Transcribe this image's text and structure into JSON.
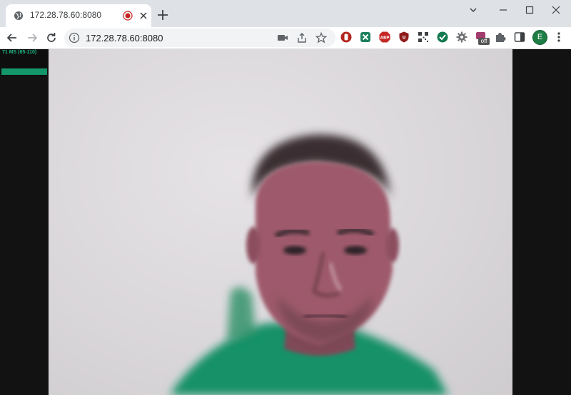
{
  "browser": {
    "tab": {
      "title": "172.28.78.60:8080"
    },
    "address_bar": {
      "url": "172.28.78.60:8080"
    },
    "extensions": [
      "video-camera-icon",
      "share-icon",
      "bookmark-star-icon",
      "extension-red-icon",
      "extension-green-x-icon",
      "adblock-icon",
      "extension-shield-icon",
      "qr-code-icon",
      "extension-check-icon",
      "extension-gear-icon",
      "extension-off-icon",
      "extensions-puzzle-icon",
      "side-panel-icon"
    ],
    "profile_initial": "E",
    "extension_badge": "off"
  },
  "stats": {
    "fps_text": "71 MS (65-110)",
    "level": 1.0
  },
  "colors": {
    "accent": "#14956b",
    "skin_overlay": "#9e5a6c",
    "shirt": "#149168"
  }
}
